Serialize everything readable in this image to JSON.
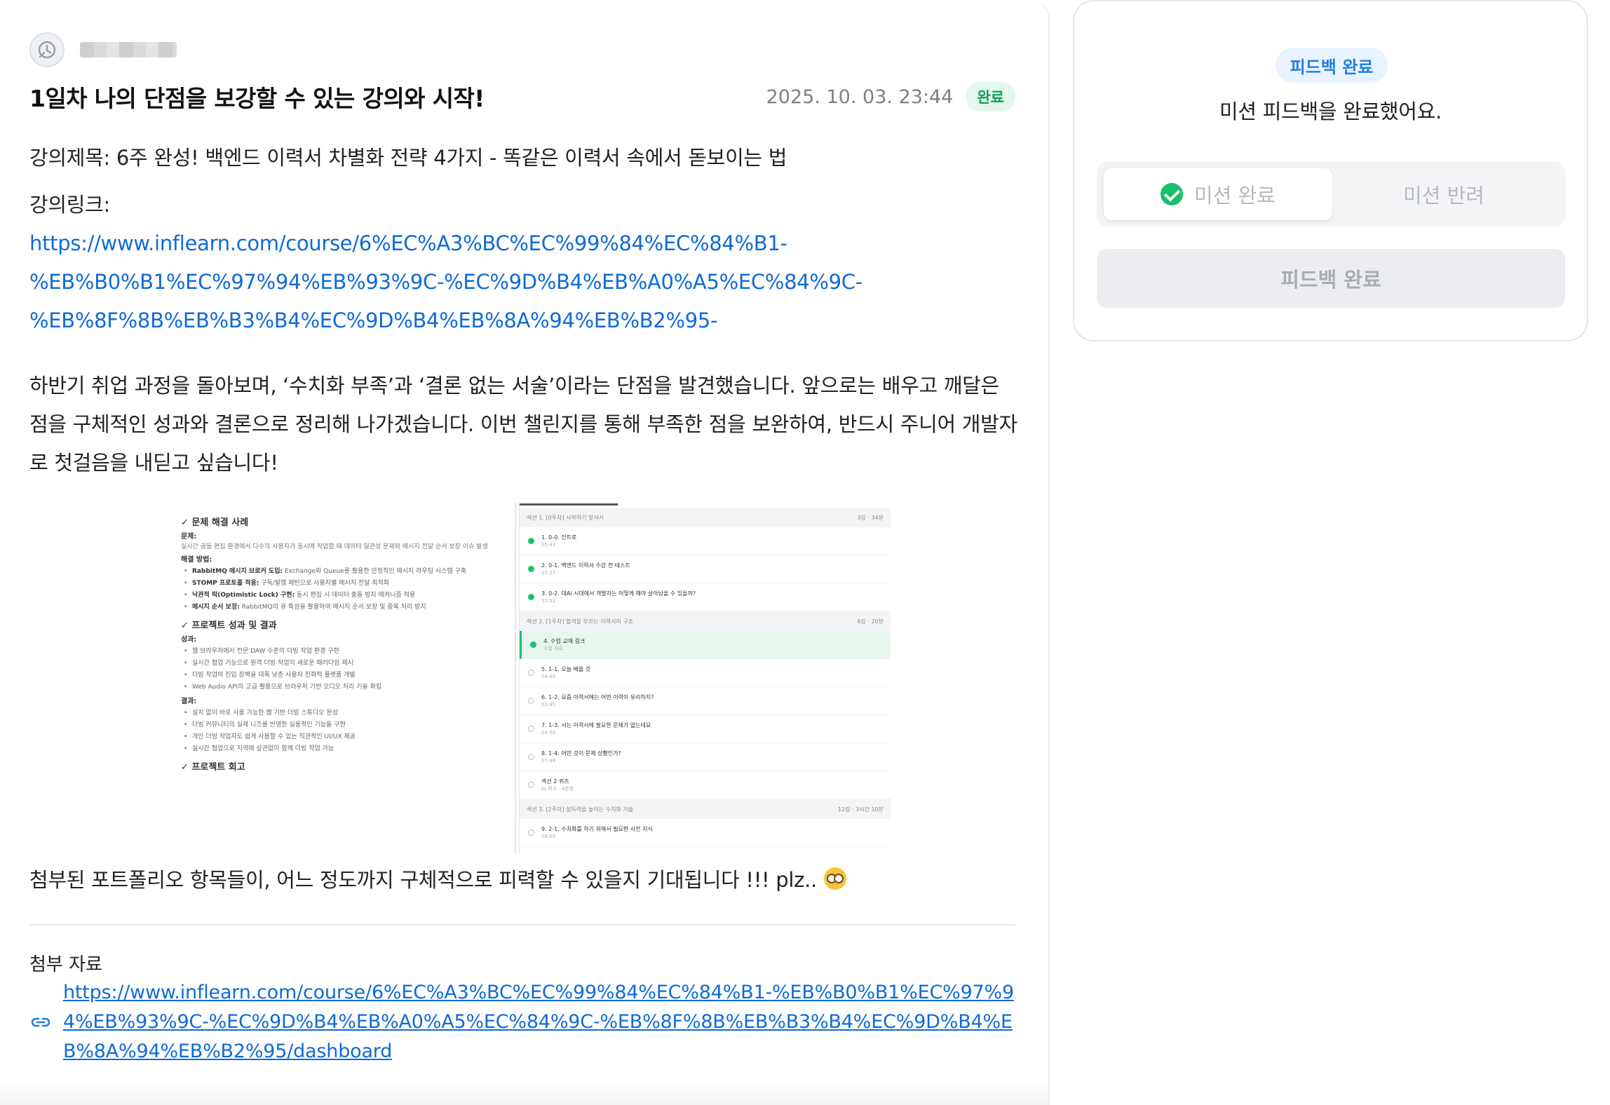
{
  "post": {
    "title": "1일차 나의 단점을 보강할 수 있는 강의와 시작!",
    "date": "2025. 10. 03. 23:44",
    "status": "완료",
    "lecture_title": "강의제목: 6주 완성! 백엔드 이력서 차별화 전략 4가지 - 똑같은 이력서 속에서 돋보이는 법",
    "lecture_link_label": "강의링크:",
    "lecture_link": "https://www.inflearn.com/course/6%EC%A3%BC%EC%99%84%EC%84%B1-%EB%B0%B1%EC%97%94%EB%93%9C-%EC%9D%B4%EB%A0%A5%EC%84%9C-%EB%8F%8B%EB%B3%B4%EC%9D%B4%EB%8A%94%EB%B2%95",
    "paragraph": "하반기 취업 과정을 돌아보며, ‘수치화 부족’과 ‘결론 없는 서술’이라는 단점을 발견했습니다. 앞으로는 배우고 깨달은 점을 구체적인 성과와 결론으로 정리해 나가겠습니다. 이번 챌린지를 통해 부족한 점을 보완하여, 반드시 주니어 개발자로 첫걸음을 내딛고 싶습니다!",
    "closing": "첨부된 포트폴리오 항목들이, 어느 정도까지 구체적으로 피력할 수 있을지 기대됩니다 !!! plz..",
    "emoji": "nerd-face-emoji"
  },
  "screenshot": {
    "left": {
      "heading1": "✓ 문제 해결 사례",
      "problem_label": "문제:",
      "problem_text": "실시간 공동 편집 환경에서 다수의 사용자가 동시에 작업할 때 데이터 일관성 문제와 메시지 전달 순서 보장 이슈 발생",
      "solution_label": "해결 방법:",
      "solutions": [
        {
          "bold": "RabbitMQ 메시지 브로커 도입:",
          "text": " Exchange와 Queue를 활용한 안정적인 메시지 라우팅 시스템 구축"
        },
        {
          "bold": "STOMP 프로토콜 적용:",
          "text": " 구독/발행 패턴으로 사용자별 메시지 전달 최적화"
        },
        {
          "bold": "낙관적 락(Optimistic Lock) 구현:",
          "text": " 동시 편집 시 데이터 충돌 방지 메커니즘 적용"
        },
        {
          "bold": "메시지 순서 보장:",
          "text": " RabbitMQ의 큐 특성을 활용하여 메시지 순서 보장 및 중복 처리 방지"
        }
      ],
      "heading2": "✓ 프로젝트 성과 및 결과",
      "result_label": "성과:",
      "results": [
        "웹 브라우저에서 전문 DAW 수준의 더빙 작업 환경 구현",
        "실시간 협업 기능으로 원격 더빙 작업의 새로운 패러다임 제시",
        "더빙 작업의 진입 장벽을 대폭 낮춘 사용자 친화적 플랫폼 개발",
        "Web Audio API의 고급 활용으로 브라우저 기반 오디오 처리 기술 확립"
      ],
      "outcome_label": "결과:",
      "outcomes": [
        "설치 없이 바로 사용 가능한 웹 기반 더빙 스튜디오 완성",
        "더빙 커뮤니티의 실제 니즈를 반영한 실용적인 기능들 구현",
        "개인 더빙 작업자도 쉽게 사용할 수 있는 직관적인 UI/UX 제공",
        "실시간 협업으로 지역에 상관없이 함께 더빙 작업 가능"
      ],
      "heading3": "✓ 프로젝트 회고"
    },
    "right": {
      "sections": [
        {
          "title": "섹션 1. [0주차] 시작하기 앞서서",
          "meta": "3강 · 34분"
        },
        {
          "title": "섹션 2. [1주차] 합격을 부르는 이력서의 구조",
          "meta": "6강 · 20분"
        },
        {
          "title": "섹션 3. [2주차] 설득력을 높이는 수치화 기술",
          "meta": "12강 · 3시간 10분"
        }
      ],
      "lessons_s1": [
        {
          "title": "1. 0-0. 인트로",
          "time": "05:43",
          "done": true
        },
        {
          "title": "2. 0-1. 백엔드 이력서 수강 전 테스트",
          "time": "15:27",
          "done": true
        },
        {
          "title": "3. 0-2. 대AI 시대에서 개발자는 어떻게 해야 살아남을 수 있을까?",
          "time": "12:52",
          "done": true
        }
      ],
      "lessons_s2": [
        {
          "title": "4. 수업 교재 링크",
          "time": "수업 자료",
          "done": true,
          "active": true
        },
        {
          "title": "5. 1-1. 오늘 배울 것",
          "time": "04:48",
          "done": false
        },
        {
          "title": "6. 1-2. 요즘 이력서에는 어떤 이력이 유리하지?",
          "time": "03:45",
          "done": false
        },
        {
          "title": "7. 1-3. 서는 이력서에 필요한 문제가 없는데요",
          "time": "04:50",
          "done": false
        },
        {
          "title": "8. 1-4. 어떤 것이 문제 상황인가?",
          "time": "07:48",
          "done": false
        },
        {
          "title": "섹션 2 퀴즈",
          "time": "to 퀴즈 · 4문항",
          "done": false
        }
      ],
      "lessons_s3": [
        {
          "title": "9. 2-1. 수치화를 하기 위해서 필요한 사전 지식",
          "time": "08:09",
          "done": false
        }
      ]
    }
  },
  "attachments": {
    "label": "첨부 자료",
    "link": "https://www.inflearn.com/course/6%EC%A3%BC%EC%99%84%EC%84%B1-%EB%B0%B1%EC%97%94%EB%93%9C-%EC%9D%B4%EB%A0%A5%EC%84%9C-%EB%8F%8B%EB%B3%B4%EC%9D%B4%EB%8A%94%EB%B2%95/dashboard"
  },
  "feedback": {
    "badge": "피드백 완료",
    "message": "미션 피드백을 완료했어요.",
    "option_complete": "미션 완료",
    "option_reject": "미션 반려",
    "submit_label": "피드백 완료"
  },
  "colors": {
    "link": "#0f6bd6",
    "success": "#17c06b",
    "badge_blue": "#1f7fe0"
  }
}
